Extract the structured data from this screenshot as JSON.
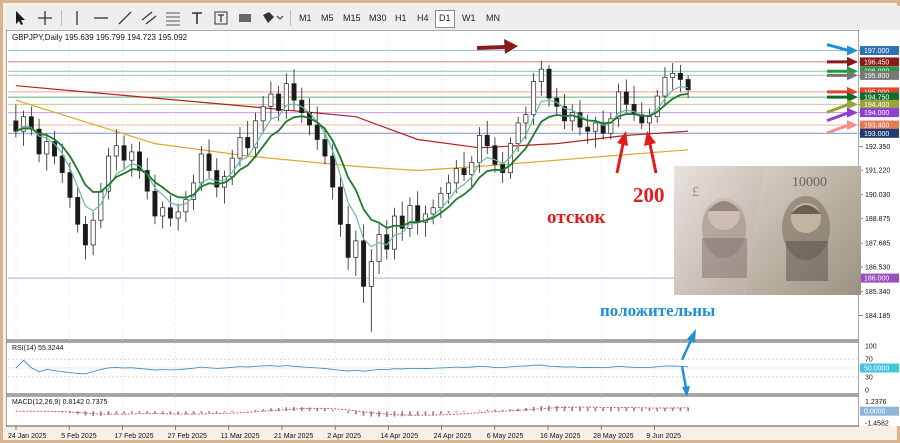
{
  "toolbar": {
    "timeframes": [
      "M1",
      "M5",
      "M15",
      "M30",
      "H1",
      "H4",
      "D1",
      "W1",
      "MN"
    ],
    "active_timeframe": "D1"
  },
  "chart_data": {
    "type": "candlestick",
    "symbol_line": "GBPJPY,Daily  195.639 195.799 194.723 195.092",
    "ylim": [
      183.2,
      197.8
    ],
    "price_ticks": [
      197.0,
      196.45,
      195.8,
      195.0,
      194.75,
      194.4,
      194.0,
      193.4,
      193.0,
      192.35,
      191.22,
      190.03,
      188.875,
      187.685,
      186.53,
      186.0,
      185.34,
      184.185
    ],
    "price_tick_labels": [
      "197.000",
      "196.450",
      "195.800",
      "195.000",
      "194.750",
      "194.400",
      "194.000",
      "193.400",
      "193.000",
      "192.350",
      "191.220",
      "190.030",
      "188.875",
      "187.685",
      "186.530",
      "186.000",
      "185.340",
      "184.185"
    ],
    "highlighted_levels": [
      {
        "price": 197.0,
        "label": "197.000",
        "bg": "#2f6fb3",
        "line": "#9dbfe6"
      },
      {
        "price": 196.45,
        "label": "196.450",
        "bg": "#8b1a1a",
        "line": "#d98080"
      },
      {
        "price": 196.0,
        "label": "196.000",
        "bg": "#1f9d3a",
        "line": "#7fcf8c"
      },
      {
        "price": 195.8,
        "label": "195.800",
        "bg": "#777777",
        "line": "#bbbbbb"
      },
      {
        "price": 195.0,
        "label": "195.000",
        "bg": "#e0452e",
        "line": "#f0a090"
      },
      {
        "price": 194.75,
        "label": "194.750",
        "bg": "#0d6e2a",
        "line": "#60b070"
      },
      {
        "price": 194.4,
        "label": "194.400",
        "bg": "#9aa33a",
        "line": "#c8cc88"
      },
      {
        "price": 194.0,
        "label": "194.000",
        "bg": "#8e3fd6",
        "line": "#c79af0"
      },
      {
        "price": 193.4,
        "label": "193.400",
        "bg": "#e67a5a",
        "line": "#f2b8a6"
      },
      {
        "price": 193.0,
        "label": "193.000",
        "bg": "#1f3b73",
        "line": "#7c8fbf"
      },
      {
        "price": 186.0,
        "label": "186.000",
        "bg": "#9b4fbf",
        "line": "#c99ad9"
      }
    ],
    "x_tick_labels": [
      "24 Jan 2025",
      "5 Feb 2025",
      "17 Feb 2025",
      "27 Feb 2025",
      "11 Mar 2025",
      "21 Mar 2025",
      "2 Apr 2025",
      "14 Apr 2025",
      "24 Apr 2025",
      "6 May 2025",
      "16 May 2025",
      "28 May 2025",
      "9 Jun 2025"
    ],
    "candles": [
      {
        "o": 193.6,
        "h": 194.4,
        "l": 192.8,
        "c": 193.1
      },
      {
        "o": 193.1,
        "h": 194.1,
        "l": 192.4,
        "c": 193.8
      },
      {
        "o": 193.8,
        "h": 194.3,
        "l": 192.9,
        "c": 193.2
      },
      {
        "o": 193.2,
        "h": 193.7,
        "l": 191.6,
        "c": 192.0
      },
      {
        "o": 192.0,
        "h": 193.0,
        "l": 191.2,
        "c": 192.6
      },
      {
        "o": 192.6,
        "h": 193.1,
        "l": 191.5,
        "c": 191.9
      },
      {
        "o": 191.9,
        "h": 192.5,
        "l": 190.6,
        "c": 191.1
      },
      {
        "o": 191.1,
        "h": 191.6,
        "l": 189.4,
        "c": 189.9
      },
      {
        "o": 189.9,
        "h": 190.4,
        "l": 188.2,
        "c": 188.6
      },
      {
        "o": 188.6,
        "h": 189.0,
        "l": 186.9,
        "c": 187.6
      },
      {
        "o": 187.6,
        "h": 189.2,
        "l": 187.1,
        "c": 188.8
      },
      {
        "o": 188.8,
        "h": 190.6,
        "l": 188.4,
        "c": 190.2
      },
      {
        "o": 190.2,
        "h": 192.3,
        "l": 189.8,
        "c": 191.9
      },
      {
        "o": 191.9,
        "h": 193.2,
        "l": 191.2,
        "c": 192.4
      },
      {
        "o": 192.4,
        "h": 192.9,
        "l": 191.3,
        "c": 191.7
      },
      {
        "o": 191.7,
        "h": 192.5,
        "l": 190.9,
        "c": 192.1
      },
      {
        "o": 192.1,
        "h": 192.6,
        "l": 190.8,
        "c": 191.2
      },
      {
        "o": 191.2,
        "h": 191.8,
        "l": 189.8,
        "c": 190.2
      },
      {
        "o": 190.2,
        "h": 191.0,
        "l": 188.6,
        "c": 189.0
      },
      {
        "o": 189.0,
        "h": 189.7,
        "l": 188.4,
        "c": 189.4
      },
      {
        "o": 189.4,
        "h": 190.0,
        "l": 188.5,
        "c": 188.9
      },
      {
        "o": 188.9,
        "h": 189.6,
        "l": 188.3,
        "c": 189.2
      },
      {
        "o": 189.2,
        "h": 190.2,
        "l": 188.7,
        "c": 189.8
      },
      {
        "o": 189.8,
        "h": 191.0,
        "l": 189.3,
        "c": 190.6
      },
      {
        "o": 190.6,
        "h": 192.4,
        "l": 190.2,
        "c": 192.0
      },
      {
        "o": 192.0,
        "h": 192.7,
        "l": 190.8,
        "c": 191.2
      },
      {
        "o": 191.2,
        "h": 191.8,
        "l": 189.9,
        "c": 190.4
      },
      {
        "o": 190.4,
        "h": 191.2,
        "l": 189.6,
        "c": 190.9
      },
      {
        "o": 190.9,
        "h": 192.2,
        "l": 190.5,
        "c": 191.8
      },
      {
        "o": 191.8,
        "h": 193.3,
        "l": 191.4,
        "c": 192.8
      },
      {
        "o": 192.8,
        "h": 193.6,
        "l": 191.9,
        "c": 192.3
      },
      {
        "o": 192.3,
        "h": 194.0,
        "l": 191.8,
        "c": 193.6
      },
      {
        "o": 193.6,
        "h": 194.8,
        "l": 193.0,
        "c": 194.3
      },
      {
        "o": 194.3,
        "h": 195.5,
        "l": 193.7,
        "c": 194.9
      },
      {
        "o": 194.9,
        "h": 195.3,
        "l": 193.6,
        "c": 194.1
      },
      {
        "o": 194.1,
        "h": 195.9,
        "l": 193.7,
        "c": 195.4
      },
      {
        "o": 195.4,
        "h": 196.1,
        "l": 194.1,
        "c": 194.6
      },
      {
        "o": 194.6,
        "h": 195.2,
        "l": 193.5,
        "c": 194.0
      },
      {
        "o": 194.0,
        "h": 194.7,
        "l": 192.9,
        "c": 193.4
      },
      {
        "o": 193.4,
        "h": 194.3,
        "l": 192.2,
        "c": 192.7
      },
      {
        "o": 192.7,
        "h": 193.3,
        "l": 191.5,
        "c": 191.9
      },
      {
        "o": 191.9,
        "h": 192.5,
        "l": 189.8,
        "c": 190.4
      },
      {
        "o": 190.4,
        "h": 190.9,
        "l": 188.0,
        "c": 188.6
      },
      {
        "o": 188.6,
        "h": 189.5,
        "l": 186.4,
        "c": 187.0
      },
      {
        "o": 187.0,
        "h": 188.3,
        "l": 186.1,
        "c": 187.8
      },
      {
        "o": 187.8,
        "h": 188.6,
        "l": 184.8,
        "c": 185.6
      },
      {
        "o": 185.6,
        "h": 187.4,
        "l": 183.4,
        "c": 186.8
      },
      {
        "o": 186.8,
        "h": 188.6,
        "l": 186.2,
        "c": 188.1
      },
      {
        "o": 188.1,
        "h": 188.8,
        "l": 186.9,
        "c": 187.4
      },
      {
        "o": 187.4,
        "h": 189.4,
        "l": 186.9,
        "c": 189.0
      },
      {
        "o": 189.0,
        "h": 189.7,
        "l": 187.8,
        "c": 188.4
      },
      {
        "o": 188.4,
        "h": 189.9,
        "l": 188.0,
        "c": 189.5
      },
      {
        "o": 189.5,
        "h": 190.2,
        "l": 188.1,
        "c": 188.7
      },
      {
        "o": 188.7,
        "h": 189.5,
        "l": 188.0,
        "c": 189.1
      },
      {
        "o": 189.1,
        "h": 189.8,
        "l": 188.6,
        "c": 189.4
      },
      {
        "o": 189.4,
        "h": 190.4,
        "l": 188.9,
        "c": 190.1
      },
      {
        "o": 190.1,
        "h": 191.0,
        "l": 189.6,
        "c": 190.6
      },
      {
        "o": 190.6,
        "h": 191.7,
        "l": 190.1,
        "c": 191.3
      },
      {
        "o": 191.3,
        "h": 192.1,
        "l": 190.7,
        "c": 191.0
      },
      {
        "o": 191.0,
        "h": 191.9,
        "l": 190.4,
        "c": 191.6
      },
      {
        "o": 191.6,
        "h": 193.3,
        "l": 191.1,
        "c": 192.9
      },
      {
        "o": 192.9,
        "h": 193.6,
        "l": 192.0,
        "c": 192.4
      },
      {
        "o": 192.4,
        "h": 192.8,
        "l": 191.1,
        "c": 191.5
      },
      {
        "o": 191.5,
        "h": 192.1,
        "l": 190.6,
        "c": 191.1
      },
      {
        "o": 191.1,
        "h": 192.8,
        "l": 190.8,
        "c": 192.5
      },
      {
        "o": 192.5,
        "h": 193.8,
        "l": 192.1,
        "c": 193.5
      },
      {
        "o": 193.5,
        "h": 194.3,
        "l": 192.7,
        "c": 193.9
      },
      {
        "o": 193.9,
        "h": 195.9,
        "l": 193.4,
        "c": 195.5
      },
      {
        "o": 195.5,
        "h": 196.5,
        "l": 194.8,
        "c": 196.1
      },
      {
        "o": 196.1,
        "h": 196.3,
        "l": 194.3,
        "c": 194.7
      },
      {
        "o": 194.7,
        "h": 195.2,
        "l": 193.9,
        "c": 194.3
      },
      {
        "o": 194.3,
        "h": 194.9,
        "l": 193.2,
        "c": 193.6
      },
      {
        "o": 193.6,
        "h": 194.4,
        "l": 193.1,
        "c": 194.0
      },
      {
        "o": 194.0,
        "h": 194.6,
        "l": 192.9,
        "c": 193.3
      },
      {
        "o": 193.3,
        "h": 193.9,
        "l": 192.5,
        "c": 193.1
      },
      {
        "o": 193.1,
        "h": 193.8,
        "l": 192.3,
        "c": 193.5
      },
      {
        "o": 193.5,
        "h": 194.1,
        "l": 192.7,
        "c": 193.0
      },
      {
        "o": 193.0,
        "h": 194.0,
        "l": 192.7,
        "c": 193.7
      },
      {
        "o": 193.7,
        "h": 195.4,
        "l": 193.3,
        "c": 195.0
      },
      {
        "o": 195.0,
        "h": 195.6,
        "l": 194.0,
        "c": 194.4
      },
      {
        "o": 194.4,
        "h": 195.3,
        "l": 193.6,
        "c": 193.9
      },
      {
        "o": 193.9,
        "h": 194.5,
        "l": 193.2,
        "c": 193.5
      },
      {
        "o": 193.5,
        "h": 194.2,
        "l": 192.9,
        "c": 193.8
      },
      {
        "o": 193.8,
        "h": 195.1,
        "l": 193.5,
        "c": 194.8
      },
      {
        "o": 194.8,
        "h": 196.2,
        "l": 194.3,
        "c": 195.7
      },
      {
        "o": 195.7,
        "h": 196.4,
        "l": 195.1,
        "c": 195.9
      },
      {
        "o": 195.9,
        "h": 196.3,
        "l": 195.0,
        "c": 195.6
      },
      {
        "o": 195.6,
        "h": 195.8,
        "l": 194.7,
        "c": 195.1
      }
    ],
    "moving_averages": [
      {
        "name": "MA 200",
        "color": "#b22222",
        "points": [
          [
            0,
            195.3
          ],
          [
            30,
            194.3
          ],
          [
            44,
            193.8
          ],
          [
            52,
            192.7
          ],
          [
            60,
            192.3
          ],
          [
            70,
            192.5
          ],
          [
            79,
            192.9
          ],
          [
            87,
            193.1
          ]
        ]
      },
      {
        "name": "MA 100",
        "color": "#e0a62e",
        "points": [
          [
            0,
            194.6
          ],
          [
            18,
            192.5
          ],
          [
            30,
            191.9
          ],
          [
            44,
            191.4
          ],
          [
            52,
            191.2
          ],
          [
            60,
            191.4
          ],
          [
            70,
            191.7
          ],
          [
            80,
            192.0
          ],
          [
            87,
            192.2
          ]
        ]
      }
    ],
    "annotations": [
      {
        "text": "отскок",
        "color": "#e01c1c",
        "x_index": 71.5,
        "price": 190.2
      },
      {
        "text": "200",
        "color": "#e01c1c",
        "x_index": 81.5,
        "price": 190.2
      },
      {
        "text": "положительны",
        "color": "#1f8fd6",
        "x_index": 75,
        "price": 0
      }
    ],
    "rsi": {
      "label": "RSI(14) 55.3244",
      "levels": [
        "100",
        "70",
        "30",
        "0"
      ],
      "current_label": "50.0000",
      "ylim": [
        0,
        100
      ]
    },
    "macd": {
      "label": "MACD(12,26,9) 0.8142 0.7375",
      "levels": [
        "1.2376",
        "-1.4582"
      ],
      "current_label": "0.0000",
      "ylim": [
        -1.6,
        1.4
      ]
    }
  }
}
